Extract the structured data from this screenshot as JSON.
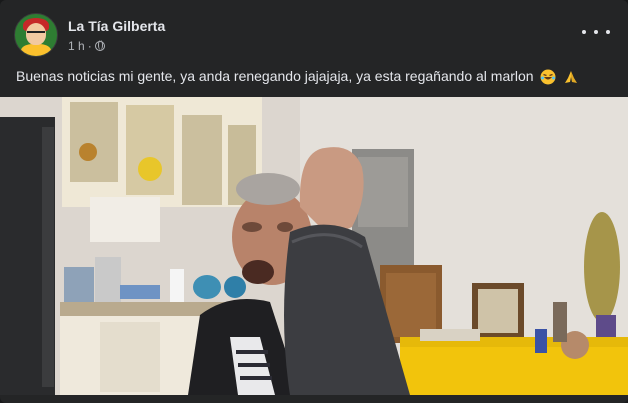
{
  "post": {
    "author": "La Tía Gilberta",
    "time": "1 h",
    "dot": "·",
    "privacy_icon": "globe-icon",
    "caption": "Buenas noticias mi gente, ya anda renegando jajajaja, ya esta regañando al marlon",
    "emojis": [
      "rolling-on-floor-laughing",
      "folded-hands"
    ]
  },
  "colors": {
    "card_bg": "#242526",
    "text_primary": "#e4e6eb",
    "text_secondary": "#b0b3b8"
  }
}
